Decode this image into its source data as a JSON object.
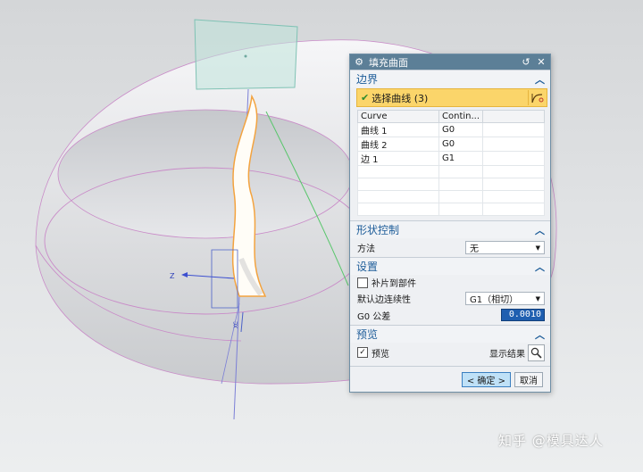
{
  "dialog": {
    "title": "填充曲面",
    "boundary": {
      "heading": "边界",
      "select_label": "选择曲线 (3)",
      "columns": [
        "Curve",
        "Contin..."
      ],
      "rows": [
        {
          "curve": "曲线 1",
          "continuity": "G0"
        },
        {
          "curve": "曲线 2",
          "continuity": "G0"
        },
        {
          "curve": "边 1",
          "continuity": "G1"
        }
      ]
    },
    "shape_control": {
      "heading": "形状控制",
      "method_label": "方法",
      "method_value": "无"
    },
    "settings": {
      "heading": "设置",
      "patch_label": "补片到部件",
      "continuity_label": "默认边连续性",
      "continuity_value": "G1（相切）",
      "tolerance_label": "G0 公差",
      "tolerance_value": "0.0010"
    },
    "preview": {
      "heading": "预览",
      "preview_label": "预览",
      "show_result_label": "显示结果"
    },
    "buttons": {
      "ok": "< 确定 >",
      "cancel": "取消"
    }
  },
  "viewport": {
    "axis_z_label": "Z",
    "axis_x_label": "XC"
  },
  "watermark": "知乎 @模具达人",
  "colors": {
    "titlebar": "#5c7f97",
    "section_heading": "#1e5d99",
    "selected_row": "#fbd56a"
  }
}
